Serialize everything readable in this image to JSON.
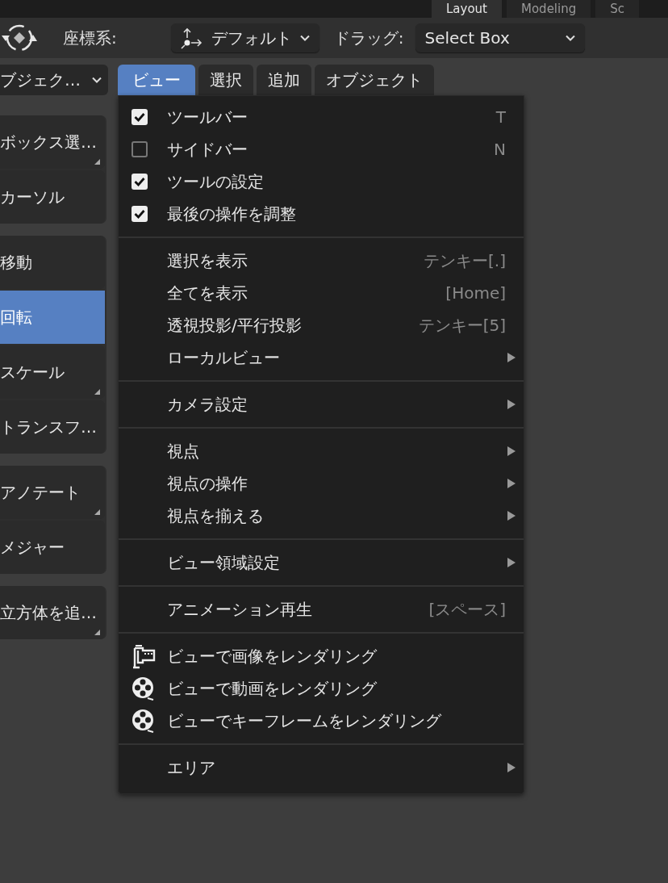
{
  "workspace_tabs": [
    {
      "label": "Layout",
      "selected": true
    },
    {
      "label": "Modeling",
      "selected": false
    },
    {
      "label": "Sc",
      "selected": false
    }
  ],
  "header": {
    "orientation_label": "座標系:",
    "orientation_value": "デフォルト",
    "drag_label": "ドラッグ:",
    "drag_value": "Select Box"
  },
  "mode_dropdown": "ブジェク…",
  "menu_tabs": [
    {
      "label": "ビュー",
      "selected": true
    },
    {
      "label": "選択",
      "selected": false
    },
    {
      "label": "追加",
      "selected": false
    },
    {
      "label": "オブジェクト",
      "selected": false
    }
  ],
  "toolbar": {
    "groups": [
      [
        {
          "label": "ボックス選…",
          "selected": false,
          "has_variants": true
        },
        {
          "label": "カーソル",
          "selected": false,
          "has_variants": false
        }
      ],
      [
        {
          "label": "移動",
          "selected": false,
          "has_variants": false
        },
        {
          "label": "回転",
          "selected": true,
          "has_variants": false
        },
        {
          "label": "スケール",
          "selected": false,
          "has_variants": true
        },
        {
          "label": "トランスフ…",
          "selected": false,
          "has_variants": false
        }
      ],
      [
        {
          "label": "アノテート",
          "selected": false,
          "has_variants": true
        },
        {
          "label": "メジャー",
          "selected": false,
          "has_variants": false
        }
      ],
      [
        {
          "label": "立方体を追…",
          "selected": false,
          "has_variants": true
        }
      ]
    ]
  },
  "view_menu": {
    "sections": [
      [
        {
          "kind": "check",
          "label": "ツールバー",
          "checked": true,
          "shortcut": "T"
        },
        {
          "kind": "check",
          "label": "サイドバー",
          "checked": false,
          "shortcut": "N"
        },
        {
          "kind": "check",
          "label": "ツールの設定",
          "checked": true
        },
        {
          "kind": "check",
          "label": "最後の操作を調整",
          "checked": true
        }
      ],
      [
        {
          "kind": "plain",
          "label": "選択を表示",
          "shortcut": "テンキー[.]"
        },
        {
          "kind": "plain",
          "label": "全てを表示",
          "shortcut": "[Home]"
        },
        {
          "kind": "plain",
          "label": "透視投影/平行投影",
          "shortcut": "テンキー[5]"
        },
        {
          "kind": "submenu",
          "label": "ローカルビュー"
        }
      ],
      [
        {
          "kind": "submenu",
          "label": "カメラ設定"
        }
      ],
      [
        {
          "kind": "submenu",
          "label": "視点"
        },
        {
          "kind": "submenu",
          "label": "視点の操作"
        },
        {
          "kind": "submenu",
          "label": "視点を揃える"
        }
      ],
      [
        {
          "kind": "submenu",
          "label": "ビュー領域設定"
        }
      ],
      [
        {
          "kind": "plain",
          "label": "アニメーション再生",
          "shortcut": "[スペース]"
        }
      ],
      [
        {
          "kind": "image",
          "label": "ビューで画像をレンダリング"
        },
        {
          "kind": "film",
          "label": "ビューで動画をレンダリング"
        },
        {
          "kind": "film",
          "label": "ビューでキーフレームをレンダリング"
        }
      ],
      [
        {
          "kind": "submenu",
          "label": "エリア"
        }
      ]
    ]
  }
}
